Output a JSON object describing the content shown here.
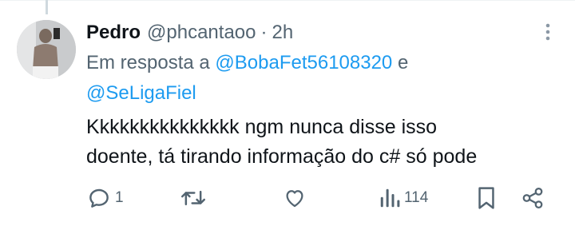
{
  "tweet": {
    "author_name": "Pedro",
    "handle": "@phcantaoo",
    "separator": "·",
    "time": "2h",
    "reply_prefix": "Em resposta a",
    "reply_to": [
      "@BobaFet56108320",
      "@SeLigaFiel"
    ],
    "reply_joiner": "e",
    "text_line1": "Kkkkkkkkkkkkkkk ngm nunca disse isso",
    "text_line2": "doente, tá tirando informação do c# só pode"
  },
  "actions": {
    "reply_count": "1",
    "retweet_count": "",
    "like_count": "",
    "views_count": "114"
  },
  "icons": {
    "reply": "reply-icon",
    "retweet": "retweet-icon",
    "like": "heart-icon",
    "views": "views-chart-icon",
    "bookmark": "bookmark-icon",
    "share": "share-icon",
    "more": "more-vertical-icon"
  },
  "colors": {
    "text_primary": "#0f1419",
    "text_secondary": "#536471",
    "mention": "#1d9bf0"
  }
}
